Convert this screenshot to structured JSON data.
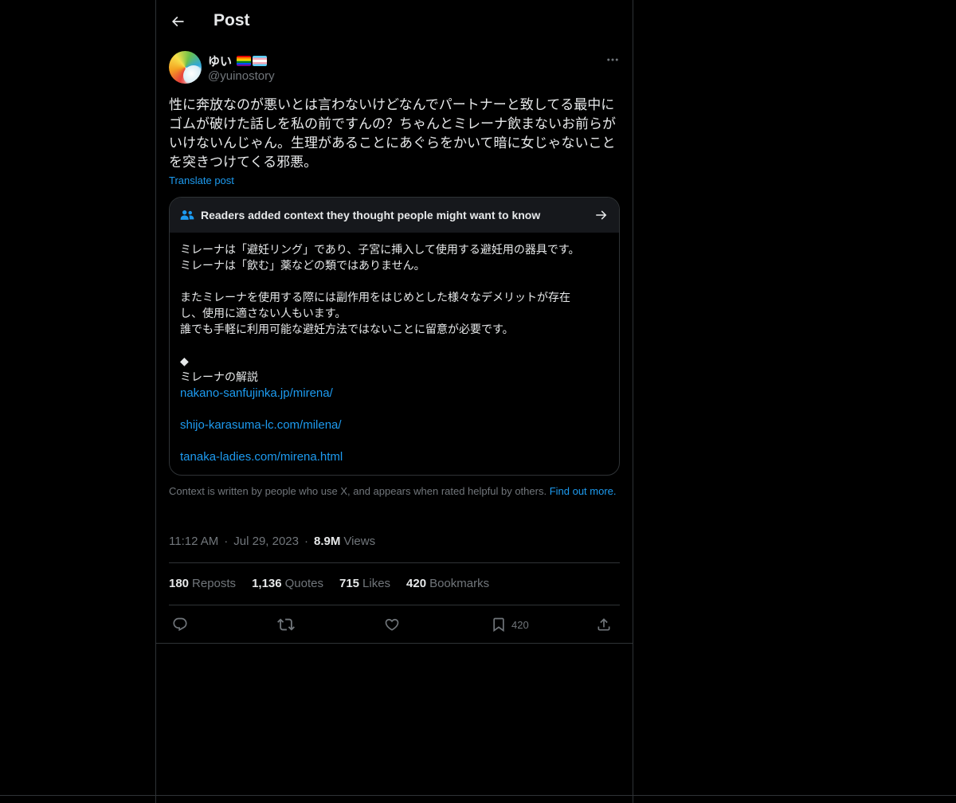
{
  "header": {
    "title": "Post"
  },
  "author": {
    "display_name": "ゆい",
    "handle": "@yuinostory"
  },
  "post": {
    "text": "性に奔放なのが悪いとは言わないけどなんでパートナーと致してる最中にゴムが破けた話しを私の前ですんの？ちゃんとミレーナ飲まないお前らがいけないんじゃん。生理があることにあぐらをかいて暗に女じゃないことを突きつけてくる邪悪。",
    "translate_label": "Translate post"
  },
  "community_note": {
    "header": "Readers added context they thought people might want to know",
    "lines": [
      "ミレーナは「避妊リング」であり、子宮に挿入して使用する避妊用の器具です。",
      "ミレーナは「飲む」薬などの類ではありません。",
      "",
      "またミレーナを使用する際には副作用をはじめとした様々なデメリットが存在",
      "し、使用に適さない人もいます。",
      "誰でも手軽に利用可能な避妊方法ではないことに留意が必要です。",
      "",
      "◆",
      "ミレーナの解説"
    ],
    "links": [
      "nakano-sanfujinka.jp/mirena/",
      "shijo-karasuma-lc.com/milena/",
      "tanaka-ladies.com/mirena.html"
    ],
    "disclaimer": "Context is written by people who use X, and appears when rated helpful by others.",
    "find_out_more": "Find out more."
  },
  "meta": {
    "time": "11:12 AM",
    "date": "Jul 29, 2023",
    "views_count": "8.9M",
    "views_label": "Views"
  },
  "stats": {
    "reposts": {
      "count": "180",
      "label": "Reposts"
    },
    "quotes": {
      "count": "1,136",
      "label": "Quotes"
    },
    "likes": {
      "count": "715",
      "label": "Likes"
    },
    "bookmarks": {
      "count": "420",
      "label": "Bookmarks"
    }
  },
  "actions": {
    "bookmark_count": "420"
  },
  "icons": {
    "back": "arrow-left-icon",
    "more": "ellipsis-icon",
    "note": "people-icon",
    "note_arrow": "arrow-right-icon",
    "reply": "reply-icon",
    "repost": "repost-icon",
    "like": "heart-icon",
    "bookmark": "bookmark-icon",
    "share": "share-icon"
  },
  "colors": {
    "accent": "#1d9bf0",
    "background": "#000000",
    "text": "#e7e9ea",
    "muted": "#71767b",
    "border": "#2f3336"
  }
}
